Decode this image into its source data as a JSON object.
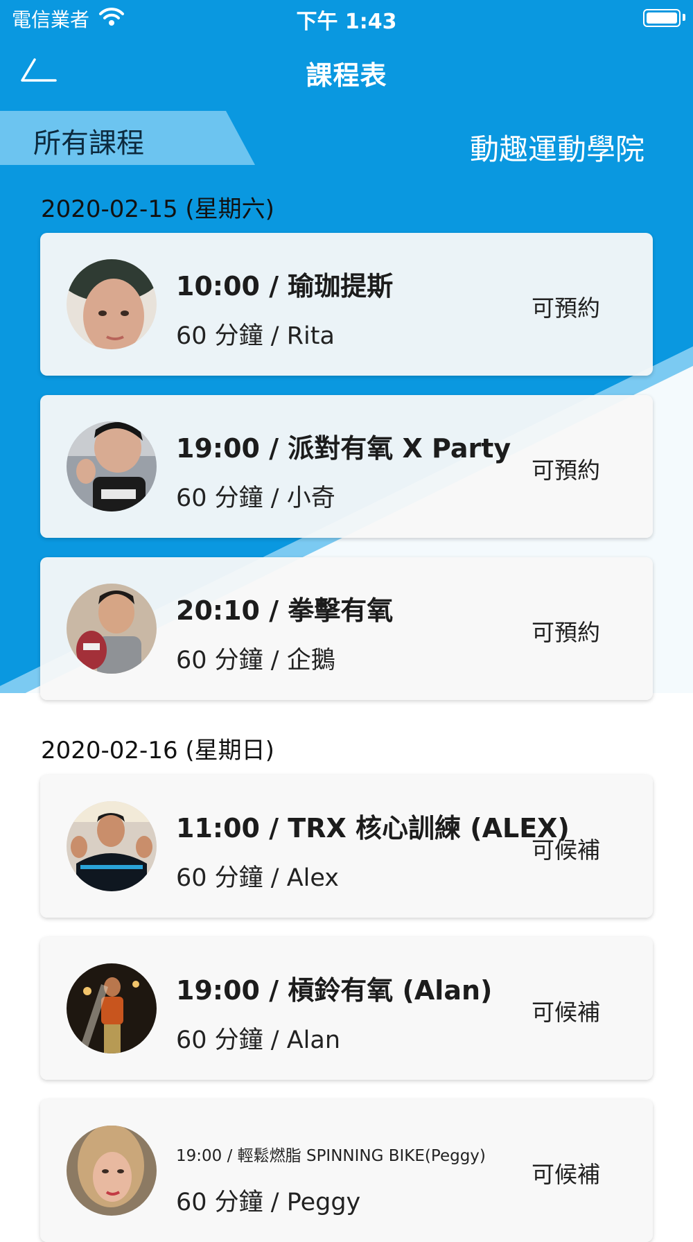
{
  "status_bar": {
    "carrier": "電信業者",
    "time": "下午 1:43"
  },
  "nav": {
    "title": "課程表"
  },
  "tabs": {
    "active": "所有課程",
    "venue": "動趣運動學院"
  },
  "days": [
    {
      "date": "2020-02-15 (星期六)",
      "classes": [
        {
          "title": "10:00 / 瑜珈提斯",
          "subtitle": "60 分鐘 / Rita",
          "status": "可預約",
          "avatar_colors": [
            "#2f3b33",
            "#d9a88f"
          ]
        },
        {
          "title": "19:00 / 派對有氧 X Party",
          "subtitle": "60 分鐘 / 小奇",
          "status": "可預約",
          "avatar_colors": [
            "#8a8f98",
            "#1b1b1b"
          ]
        },
        {
          "title": "20:10 / 拳擊有氧",
          "subtitle": "60 分鐘 / 企鵝",
          "status": "可預約",
          "avatar_colors": [
            "#c9b8a5",
            "#a33039"
          ]
        }
      ]
    },
    {
      "date": "2020-02-16 (星期日)",
      "classes": [
        {
          "title": "11:00 / TRX 核心訓練 (ALEX)",
          "subtitle": "60 分鐘 / Alex",
          "status": "可候補",
          "avatar_colors": [
            "#d9cfc4",
            "#0f1720"
          ]
        },
        {
          "title": "19:00 / 槓鈴有氧 (Alan)",
          "subtitle": "60 分鐘 / Alan",
          "status": "可候補",
          "avatar_colors": [
            "#1e1710",
            "#c8551e"
          ]
        },
        {
          "title": "19:00 / 輕鬆燃脂 SPINNING BIKE(Peggy)",
          "subtitle": "60 分鐘 / Peggy",
          "status": "可候補",
          "avatar_colors": [
            "#caa77a",
            "#e8b9a0"
          ]
        }
      ]
    }
  ]
}
